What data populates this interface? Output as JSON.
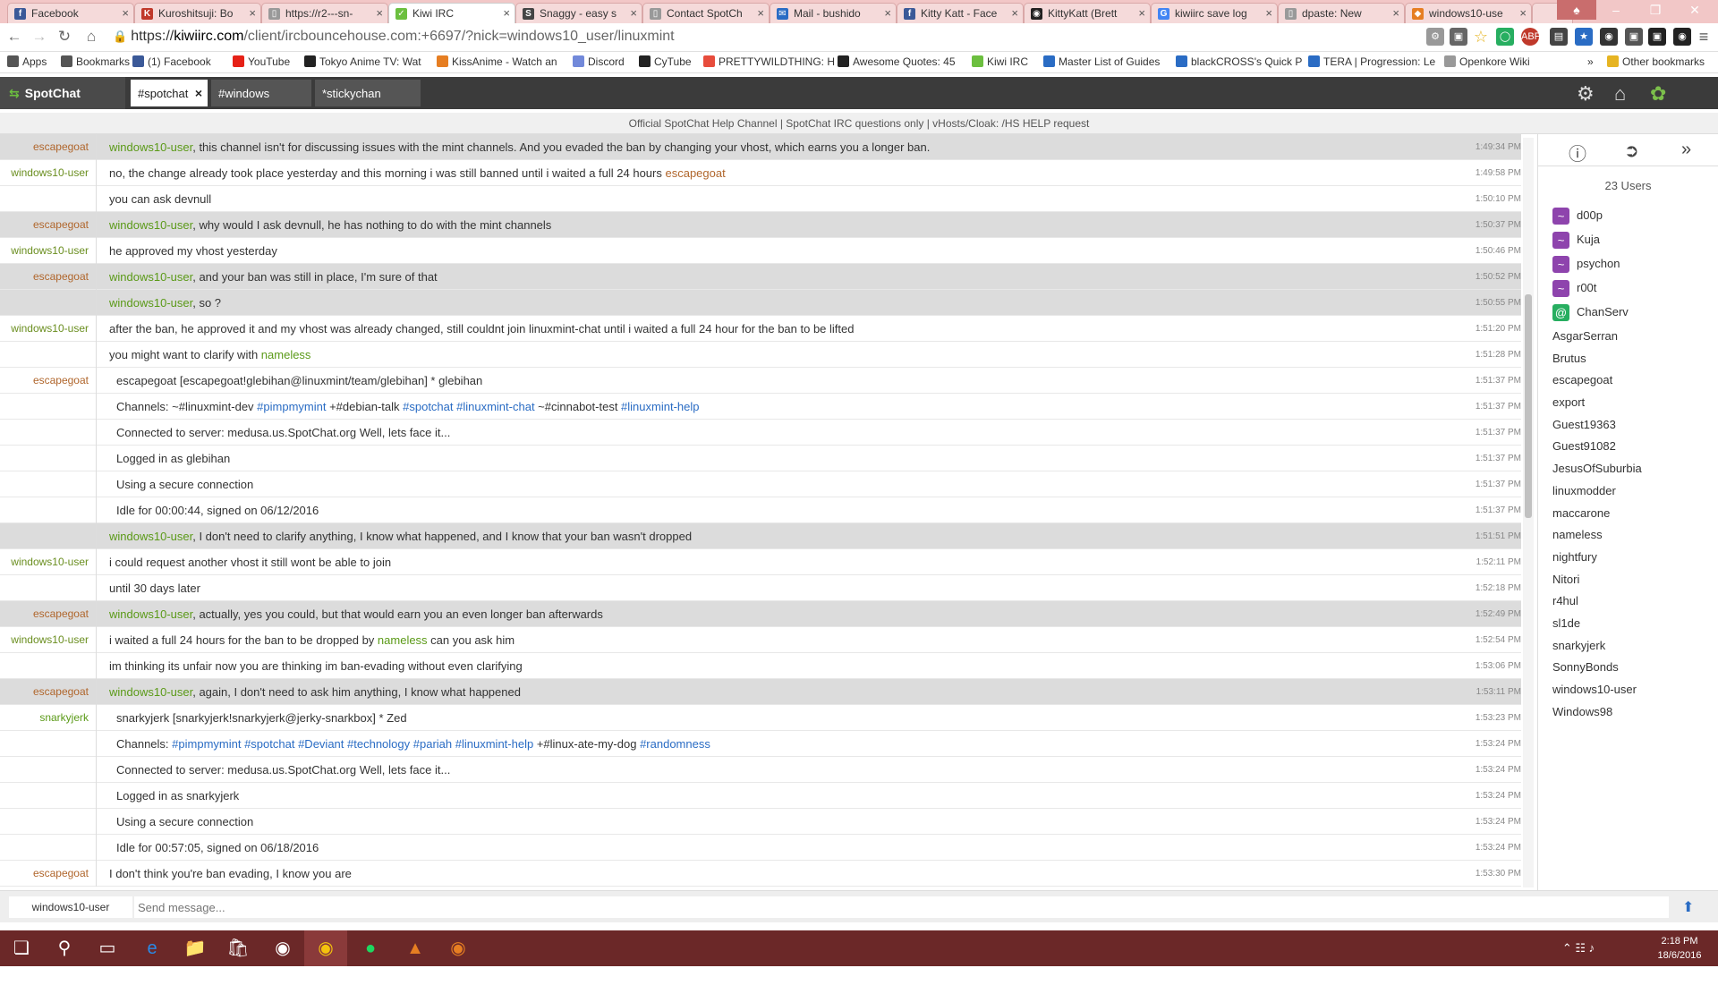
{
  "browser": {
    "tabs": [
      {
        "label": "Facebook",
        "fav": "f",
        "color": "#3b5998"
      },
      {
        "label": "Kuroshitsuji: Bo",
        "fav": "K",
        "color": "#c0392b"
      },
      {
        "label": "https://r2---sn-",
        "fav": "▯",
        "color": "#999999"
      },
      {
        "label": "Kiwi IRC",
        "fav": "✓",
        "color": "#6cbf3f"
      },
      {
        "label": "Snaggy - easy s",
        "fav": "S",
        "color": "#444444"
      },
      {
        "label": "Contact SpotCh",
        "fav": "▯",
        "color": "#999999"
      },
      {
        "label": "Mail - bushido",
        "fav": "✉",
        "color": "#2a6cc4"
      },
      {
        "label": "Kitty Katt - Face",
        "fav": "f",
        "color": "#3b5998"
      },
      {
        "label": "KittyKatt (Brett",
        "fav": "◉",
        "color": "#222222"
      },
      {
        "label": "kiwiirc save log",
        "fav": "G",
        "color": "#4285f4"
      },
      {
        "label": "dpaste: New",
        "fav": "▯",
        "color": "#999999"
      },
      {
        "label": "windows10-use",
        "fav": "◆",
        "color": "#e67e22"
      }
    ],
    "address": {
      "scheme": "https://",
      "host": "kiwiirc.com",
      "path": "/client/ircbouncehouse.com:+6697/?nick=windows10_user/linuxmint"
    },
    "bookmarks": [
      {
        "label": "Apps",
        "color": "#555555"
      },
      {
        "label": "Bookmarks",
        "color": "#555555"
      },
      {
        "label": "(1) Facebook",
        "color": "#3b5998"
      },
      {
        "label": "YouTube",
        "color": "#e62117"
      },
      {
        "label": "Tokyo Anime TV: Wat",
        "color": "#222222"
      },
      {
        "label": "KissAnime - Watch an",
        "color": "#e67e22"
      },
      {
        "label": "Discord",
        "color": "#7289da"
      },
      {
        "label": "CyTube",
        "color": "#222222"
      },
      {
        "label": "PRETTYWILDTHING: H",
        "color": "#e74c3c"
      },
      {
        "label": "Awesome Quotes: 45",
        "color": "#222222"
      },
      {
        "label": "Kiwi IRC",
        "color": "#6cbf3f"
      },
      {
        "label": "Master List of Guides",
        "color": "#2a6cc4"
      },
      {
        "label": "blackCROSS's Quick P",
        "color": "#2a6cc4"
      },
      {
        "label": "TERA | Progression: Le",
        "color": "#2a6cc4"
      },
      {
        "label": "Openkore Wiki",
        "color": "#999999"
      },
      {
        "label": "Other bookmarks",
        "color": "#e6b422"
      }
    ]
  },
  "kiwi": {
    "brand": "SpotChat",
    "tabs": [
      {
        "label": "#spotchat",
        "active": true
      },
      {
        "label": "#windows",
        "active": false
      },
      {
        "label": "*stickychan",
        "active": false
      }
    ],
    "topic": "Official SpotChat Help Channel | SpotChat IRC questions only | vHosts/Cloak: /HS HELP request"
  },
  "messages": [
    {
      "nick": "escapegoat",
      "nc": "esc",
      "hl": true,
      "time": "1:49:34 PM",
      "parts": [
        {
          "t": "windows10-user",
          "c": "mn"
        },
        {
          "t": ", this channel isn't for discussing issues with the mint channels. And you evaded the ban by changing your vhost, which earns you a longer ban."
        }
      ]
    },
    {
      "nick": "windows10-user",
      "nc": "win",
      "hl": false,
      "time": "1:49:58 PM",
      "parts": [
        {
          "t": "no, the change already took place yesterday and this morning i was still banned until i waited a full 24 hours "
        },
        {
          "t": "escapegoat",
          "c": "me"
        }
      ]
    },
    {
      "nick": "",
      "nc": "win",
      "hl": false,
      "time": "1:50:10 PM",
      "parts": [
        {
          "t": "you can ask devnull"
        }
      ]
    },
    {
      "nick": "escapegoat",
      "nc": "esc",
      "hl": true,
      "time": "1:50:37 PM",
      "parts": [
        {
          "t": "windows10-user",
          "c": "mn"
        },
        {
          "t": ", why would I ask devnull, he has nothing to do with the mint channels"
        }
      ]
    },
    {
      "nick": "windows10-user",
      "nc": "win",
      "hl": false,
      "time": "1:50:46 PM",
      "parts": [
        {
          "t": "he approved my vhost yesterday"
        }
      ]
    },
    {
      "nick": "escapegoat",
      "nc": "esc",
      "hl": true,
      "time": "1:50:52 PM",
      "parts": [
        {
          "t": "windows10-user",
          "c": "mn"
        },
        {
          "t": ", and your ban was still in place, I'm sure of that"
        }
      ]
    },
    {
      "nick": "",
      "nc": "esc",
      "hl": true,
      "time": "1:50:55 PM",
      "parts": [
        {
          "t": "windows10-user",
          "c": "mn"
        },
        {
          "t": ", so ?"
        }
      ]
    },
    {
      "nick": "windows10-user",
      "nc": "win",
      "hl": false,
      "time": "1:51:20 PM",
      "parts": [
        {
          "t": "after the ban, he approved it and my vhost was already changed, still couldnt join linuxmint-chat until i waited a full 24 hour for the ban to be lifted"
        }
      ]
    },
    {
      "nick": "",
      "nc": "win",
      "hl": false,
      "time": "1:51:28 PM",
      "parts": [
        {
          "t": "you might want to clarify with "
        },
        {
          "t": "nameless",
          "c": "mn"
        }
      ]
    },
    {
      "nick": "escapegoat",
      "nc": "esc",
      "hl": false,
      "whois": true,
      "time": "1:51:37 PM",
      "parts": [
        {
          "t": "escapegoat [escapegoat!glebihan@linuxmint/team/glebihan] * glebihan"
        }
      ]
    },
    {
      "nick": "",
      "nc": "esc",
      "hl": false,
      "whois": true,
      "time": "1:51:37 PM",
      "parts": [
        {
          "t": "Channels: ~#linuxmint-dev "
        },
        {
          "t": "#pimpmymint",
          "c": "ch"
        },
        {
          "t": " +#debian-talk "
        },
        {
          "t": "#spotchat",
          "c": "ch"
        },
        {
          "t": " "
        },
        {
          "t": "#linuxmint-chat",
          "c": "ch"
        },
        {
          "t": " ~#cinnabot-test "
        },
        {
          "t": "#linuxmint-help",
          "c": "ch"
        }
      ]
    },
    {
      "nick": "",
      "nc": "esc",
      "hl": false,
      "whois": true,
      "time": "1:51:37 PM",
      "parts": [
        {
          "t": "Connected to server: medusa.us.SpotChat.org Well, lets face it..."
        }
      ]
    },
    {
      "nick": "",
      "nc": "esc",
      "hl": false,
      "whois": true,
      "time": "1:51:37 PM",
      "parts": [
        {
          "t": "Logged in as glebihan"
        }
      ]
    },
    {
      "nick": "",
      "nc": "esc",
      "hl": false,
      "whois": true,
      "time": "1:51:37 PM",
      "parts": [
        {
          "t": "Using a secure connection"
        }
      ]
    },
    {
      "nick": "",
      "nc": "esc",
      "hl": false,
      "whois": true,
      "time": "1:51:37 PM",
      "parts": [
        {
          "t": "Idle for 00:00:44, signed on 06/12/2016"
        }
      ]
    },
    {
      "nick": "",
      "nc": "esc",
      "hl": true,
      "time": "1:51:51 PM",
      "parts": [
        {
          "t": "windows10-user",
          "c": "mn"
        },
        {
          "t": ", I don't need to clarify anything, I know what happened, and I know that your ban wasn't dropped"
        }
      ]
    },
    {
      "nick": "windows10-user",
      "nc": "win",
      "hl": false,
      "time": "1:52:11 PM",
      "parts": [
        {
          "t": "i could request another vhost it still wont be able to join"
        }
      ]
    },
    {
      "nick": "",
      "nc": "win",
      "hl": false,
      "time": "1:52:18 PM",
      "parts": [
        {
          "t": "until 30 days later"
        }
      ]
    },
    {
      "nick": "escapegoat",
      "nc": "esc",
      "hl": true,
      "time": "1:52:49 PM",
      "parts": [
        {
          "t": "windows10-user",
          "c": "mn"
        },
        {
          "t": ", actually, yes you could, but that would earn you an even longer ban afterwards"
        }
      ]
    },
    {
      "nick": "windows10-user",
      "nc": "win",
      "hl": false,
      "time": "1:52:54 PM",
      "parts": [
        {
          "t": "i waited a full 24 hours for the ban to be dropped by "
        },
        {
          "t": "nameless",
          "c": "mn"
        },
        {
          "t": " can you ask him"
        }
      ]
    },
    {
      "nick": "",
      "nc": "win",
      "hl": false,
      "time": "1:53:06 PM",
      "parts": [
        {
          "t": "im thinking its unfair now you are thinking im ban-evading without even clarifying"
        }
      ]
    },
    {
      "nick": "escapegoat",
      "nc": "esc",
      "hl": true,
      "time": "1:53:11 PM",
      "parts": [
        {
          "t": "windows10-user",
          "c": "mn"
        },
        {
          "t": ", again, I don't need to ask him anything, I know what happened"
        }
      ]
    },
    {
      "nick": "snarkyjerk",
      "nc": "snar",
      "hl": false,
      "whois": true,
      "time": "1:53:23 PM",
      "parts": [
        {
          "t": "snarkyjerk [snarkyjerk!snarkyjerk@jerky-snarkbox] * Zed"
        }
      ]
    },
    {
      "nick": "",
      "nc": "snar",
      "hl": false,
      "whois": true,
      "time": "1:53:24 PM",
      "parts": [
        {
          "t": "Channels: "
        },
        {
          "t": "#pimpmymint",
          "c": "ch"
        },
        {
          "t": " "
        },
        {
          "t": "#spotchat",
          "c": "ch"
        },
        {
          "t": " "
        },
        {
          "t": "#Deviant",
          "c": "ch"
        },
        {
          "t": " "
        },
        {
          "t": "#technology",
          "c": "ch"
        },
        {
          "t": " "
        },
        {
          "t": "#pariah",
          "c": "ch"
        },
        {
          "t": " "
        },
        {
          "t": "#linuxmint-help",
          "c": "ch"
        },
        {
          "t": " +#linux-ate-my-dog "
        },
        {
          "t": "#randomness",
          "c": "ch"
        }
      ]
    },
    {
      "nick": "",
      "nc": "snar",
      "hl": false,
      "whois": true,
      "time": "1:53:24 PM",
      "parts": [
        {
          "t": "Connected to server: medusa.us.SpotChat.org Well, lets face it..."
        }
      ]
    },
    {
      "nick": "",
      "nc": "snar",
      "hl": false,
      "whois": true,
      "time": "1:53:24 PM",
      "parts": [
        {
          "t": "Logged in as snarkyjerk"
        }
      ]
    },
    {
      "nick": "",
      "nc": "snar",
      "hl": false,
      "whois": true,
      "time": "1:53:24 PM",
      "parts": [
        {
          "t": "Using a secure connection"
        }
      ]
    },
    {
      "nick": "",
      "nc": "snar",
      "hl": false,
      "whois": true,
      "time": "1:53:24 PM",
      "parts": [
        {
          "t": "Idle for 00:57:05, signed on 06/18/2016"
        }
      ]
    },
    {
      "nick": "escapegoat",
      "nc": "esc",
      "hl": false,
      "time": "1:53:30 PM",
      "parts": [
        {
          "t": "I don't think you're ban evading, I know you are"
        }
      ]
    }
  ],
  "users": {
    "count_label": "23 Users",
    "list": [
      {
        "name": "d00p",
        "mode": "~",
        "color": "#8e44ad"
      },
      {
        "name": "Kuja",
        "mode": "~",
        "color": "#8e44ad"
      },
      {
        "name": "psychon",
        "mode": "~",
        "color": "#8e44ad"
      },
      {
        "name": "r00t",
        "mode": "~",
        "color": "#8e44ad"
      },
      {
        "name": "ChanServ",
        "mode": "@",
        "color": "#27ae60"
      },
      {
        "name": "AsgarSerran"
      },
      {
        "name": "Brutus"
      },
      {
        "name": "escapegoat"
      },
      {
        "name": "export"
      },
      {
        "name": "Guest19363"
      },
      {
        "name": "Guest91082"
      },
      {
        "name": "JesusOfSuburbia"
      },
      {
        "name": "linuxmodder"
      },
      {
        "name": "maccarone"
      },
      {
        "name": "nameless"
      },
      {
        "name": "nightfury"
      },
      {
        "name": "Nitori"
      },
      {
        "name": "r4hul"
      },
      {
        "name": "sl1de"
      },
      {
        "name": "snarkyjerk"
      },
      {
        "name": "SonnyBonds"
      },
      {
        "name": "windows10-user"
      },
      {
        "name": "Windows98"
      }
    ]
  },
  "input": {
    "nick": "windows10-user",
    "placeholder": "Send message..."
  },
  "taskbar": {
    "time": "2:18 PM",
    "date": "18/6/2016"
  }
}
